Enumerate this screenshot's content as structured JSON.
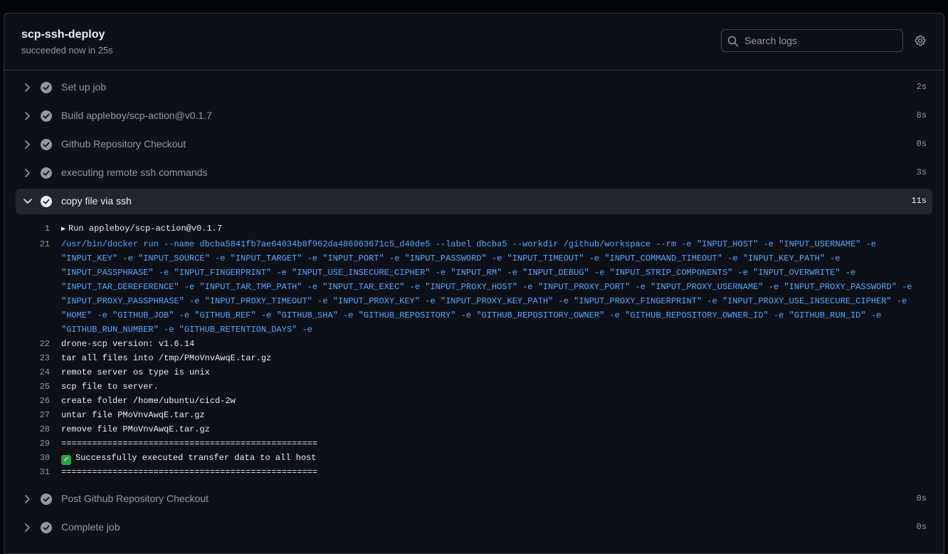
{
  "job": {
    "title": "scp-ssh-deploy",
    "subtitle": "succeeded now in 25s"
  },
  "search": {
    "placeholder": "Search logs"
  },
  "steps_before": [
    {
      "name": "Set up job",
      "duration": "2s"
    },
    {
      "name": "Build appleboy/scp-action@v0.1.7",
      "duration": "8s"
    },
    {
      "name": "Github Repository Checkout",
      "duration": "0s"
    },
    {
      "name": "executing remote ssh commands",
      "duration": "3s"
    }
  ],
  "open_step": {
    "name": "copy file via ssh",
    "duration": "11s"
  },
  "log": {
    "group_num": "1",
    "group_text": "Run appleboy/scp-action@v0.1.7",
    "cmd_num": "21",
    "cmd_text": "/usr/bin/docker run --name dbcba5841fb7ae64034b8f962da486963671c5_d40de5 --label dbcba5 --workdir /github/workspace --rm -e \"INPUT_HOST\" -e \"INPUT_USERNAME\" -e \"INPUT_KEY\" -e \"INPUT_SOURCE\" -e \"INPUT_TARGET\" -e \"INPUT_PORT\" -e \"INPUT_PASSWORD\" -e \"INPUT_TIMEOUT\" -e \"INPUT_COMMAND_TIMEOUT\" -e \"INPUT_KEY_PATH\" -e \"INPUT_PASSPHRASE\" -e \"INPUT_FINGERPRINT\" -e \"INPUT_USE_INSECURE_CIPHER\" -e \"INPUT_RM\" -e \"INPUT_DEBUG\" -e \"INPUT_STRIP_COMPONENTS\" -e \"INPUT_OVERWRITE\" -e \"INPUT_TAR_DEREFERENCE\" -e \"INPUT_TAR_TMP_PATH\" -e \"INPUT_TAR_EXEC\" -e \"INPUT_PROXY_HOST\" -e \"INPUT_PROXY_PORT\" -e \"INPUT_PROXY_USERNAME\" -e \"INPUT_PROXY_PASSWORD\" -e \"INPUT_PROXY_PASSPHRASE\" -e \"INPUT_PROXY_TIMEOUT\" -e \"INPUT_PROXY_KEY\" -e \"INPUT_PROXY_KEY_PATH\" -e \"INPUT_PROXY_FINGERPRINT\" -e \"INPUT_PROXY_USE_INSECURE_CIPHER\" -e \"HOME\" -e \"GITHUB_JOB\" -e \"GITHUB_REF\" -e \"GITHUB_SHA\" -e \"GITHUB_REPOSITORY\" -e \"GITHUB_REPOSITORY_OWNER\" -e \"GITHUB_REPOSITORY_OWNER_ID\" -e \"GITHUB_RUN_ID\" -e \"GITHUB_RUN_NUMBER\" -e \"GITHUB_RETENTION_DAYS\" -e",
    "lines": [
      {
        "num": "22",
        "text": "drone-scp version: v1.6.14"
      },
      {
        "num": "23",
        "text": "tar all files into /tmp/PMoVnvAwqE.tar.gz"
      },
      {
        "num": "24",
        "text": "remote server os type is unix"
      },
      {
        "num": "25",
        "text": "scp file to server."
      },
      {
        "num": "26",
        "text": "create folder /home/ubuntu/cicd-2w"
      },
      {
        "num": "27",
        "text": "untar file PMoVnvAwqE.tar.gz"
      },
      {
        "num": "28",
        "text": "remove file PMoVnvAwqE.tar.gz"
      },
      {
        "num": "29",
        "text": "=================================================="
      }
    ],
    "success_num": "30",
    "success_text": "Successfully executed transfer data to all host",
    "last_num": "31",
    "last_text": "=================================================="
  },
  "steps_after": [
    {
      "name": "Post Github Repository Checkout",
      "duration": "0s"
    },
    {
      "name": "Complete job",
      "duration": "0s"
    }
  ],
  "colors": {
    "background": "#010409",
    "panel": "#0d1117",
    "command_blue": "#58a6ff",
    "success_green": "#2ea043"
  },
  "icons": {
    "chevron": "chevron-right-icon",
    "chevron_open": "chevron-down-icon",
    "check": "check-circle-icon",
    "search": "search-icon",
    "gear": "gear-icon"
  }
}
